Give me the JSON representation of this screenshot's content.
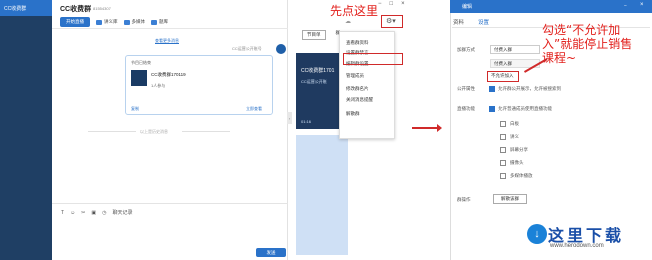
{
  "sidebar": {
    "brand": "CC收费群"
  },
  "chat": {
    "title": "CC收费群",
    "group_id": "81554307",
    "toolbar": {
      "start_live": "开始直播",
      "lecture": "讲义库",
      "media": "多媒体",
      "question_bank": "题库"
    },
    "more_link": "查看更多消息",
    "sender": "CC运营公开账号",
    "card": {
      "title": "节目已结束",
      "name": "CC收费群170119",
      "count": "1人参与",
      "copy": "复制",
      "watch": "立即查看"
    },
    "history": "以上是历史消息",
    "input_tools": {
      "record": "聊天记录"
    },
    "send": "发送"
  },
  "program": {
    "tab_1": "节目单",
    "tab_2": "群",
    "card_title": "CC收费群1701",
    "card_sub": "CC运营公开账",
    "card_time": "01:16"
  },
  "menu": {
    "items": [
      "查看群资料",
      "设置群禁言",
      "编辑群设置",
      "管理成员",
      "修改群名片",
      "关闭消息提醒",
      "解散群"
    ]
  },
  "annotations": {
    "first": "先点这里",
    "second": "勾选“不允许加入”就能停止销售课程~"
  },
  "edit": {
    "title": "编辑",
    "tab_info": "资料",
    "tab_settings": "设置",
    "join_label": "加群方式",
    "join_value": "付费入群",
    "join_option_1": "付费入群",
    "join_option_2": "不允许加入",
    "public_label": "公开属性",
    "public_text": "允许群公开展示，允许被搜索到",
    "live_label": "直播功能",
    "live_main": "允许普通成员使用直播功能",
    "live_subs": [
      "白板",
      "讲义",
      "屏幕分享",
      "摄像头",
      "多媒体播放"
    ],
    "group_ops_label": "群操作",
    "dismiss": "解散该群"
  },
  "watermark": {
    "text": "这里下载",
    "url": "www.herodown.com",
    "logo": "↓"
  }
}
